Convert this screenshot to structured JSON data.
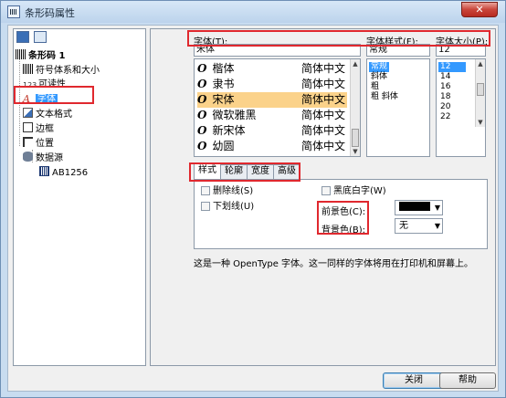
{
  "window": {
    "title": "条形码属性",
    "close_label": "✕"
  },
  "tree": {
    "items": [
      {
        "label": "条形码 1",
        "icon": "barcode-icon"
      },
      {
        "label": "符号体系和大小",
        "icon": "barcode-icon"
      },
      {
        "label": "可读性",
        "icon": "digits-icon",
        "prefix": "123"
      },
      {
        "label": "字体",
        "icon": "font-icon",
        "glyph": "A"
      },
      {
        "label": "文本格式",
        "icon": "text-format-icon"
      },
      {
        "label": "边框",
        "icon": "border-icon"
      },
      {
        "label": "位置",
        "icon": "position-icon"
      },
      {
        "label": "数据源",
        "icon": "database-icon"
      },
      {
        "label": "AB1256",
        "icon": "barcode-data-icon"
      }
    ]
  },
  "font": {
    "label": "字体(T):",
    "value": "宋体",
    "list": [
      {
        "name": "楷体",
        "sample": "简体中文"
      },
      {
        "name": "隶书",
        "sample": "简体中文"
      },
      {
        "name": "宋体",
        "sample": "简体中文"
      },
      {
        "name": "微软雅黑",
        "sample": "简体中文"
      },
      {
        "name": "新宋体",
        "sample": "简体中文"
      },
      {
        "name": "幼圆",
        "sample": "简体中文"
      }
    ],
    "selected_index": 2
  },
  "style": {
    "label": "字体样式(F):",
    "value": "常规",
    "options": [
      "常规",
      "斜体",
      "粗",
      "粗 斜体"
    ],
    "selected_index": 0
  },
  "size": {
    "label": "字体大小(P):",
    "value": "12",
    "options": [
      "12",
      "14",
      "16",
      "18",
      "20",
      "22"
    ],
    "selected_index": 0
  },
  "tabs": [
    "样式",
    "轮廓",
    "宽度",
    "高级"
  ],
  "active_tab": 0,
  "effects": {
    "strike": "删除线(S)",
    "underline": "下划线(U)",
    "black_white": "黑底白字(W)",
    "fg_label": "前景色(C):",
    "bg_label": "背景色(B):",
    "fg_color": "#000000",
    "bg_value": "无"
  },
  "description": "这是一种 OpenType 字体。这一同样的字体将用在打印机和屏幕上。",
  "buttons": {
    "close": "关闭",
    "help": "帮助"
  }
}
